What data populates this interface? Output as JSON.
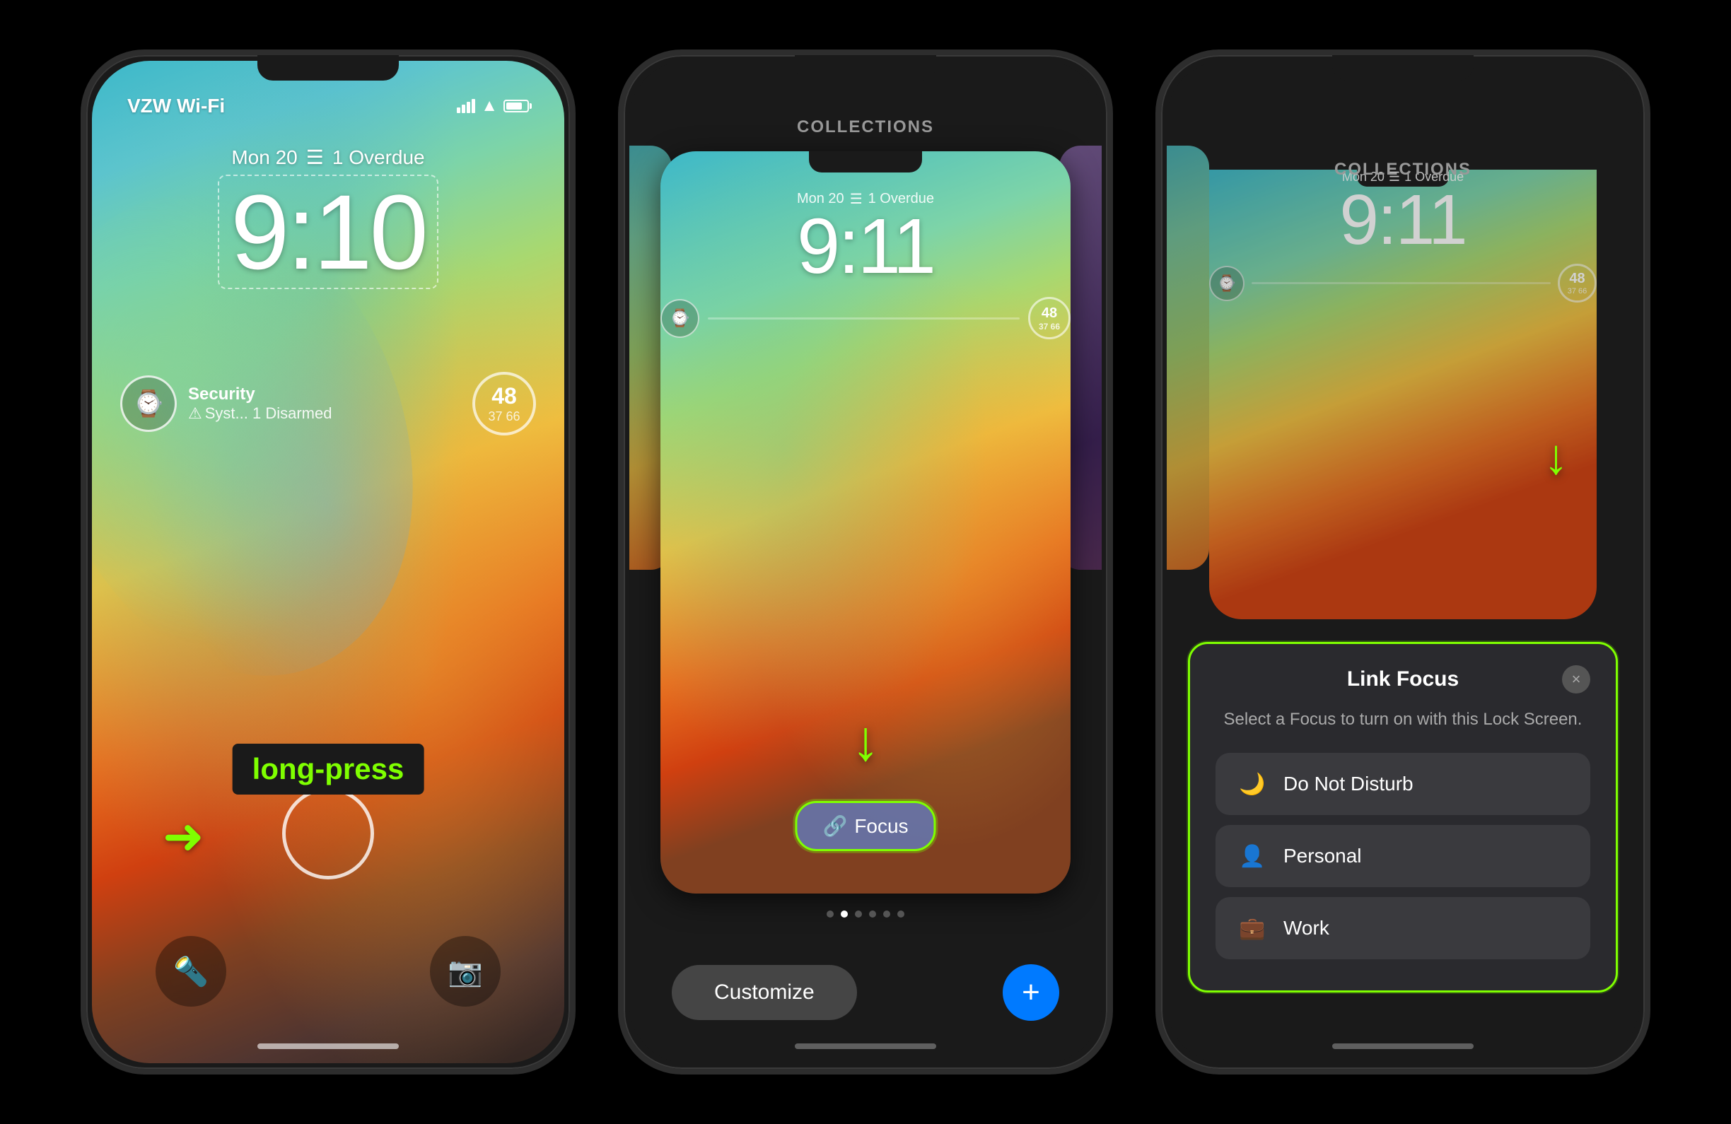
{
  "page": {
    "background": "#000000"
  },
  "phone1": {
    "status": {
      "carrier": "VZW Wi-Fi",
      "time_display": "9:10"
    },
    "date_row": {
      "date": "Mon 20",
      "overdue": "1 Overdue"
    },
    "time": "9:10",
    "widgets": {
      "security_title": "Security",
      "security_sub": "Syst... 1 Disarmed",
      "temp": "48",
      "temp_range": "37  66"
    },
    "annotation": "long-press",
    "bottom": {
      "flashlight_icon": "🔦",
      "camera_icon": "📷"
    }
  },
  "phone2": {
    "title": "COLLECTIONS",
    "time": "9:11",
    "date_row": {
      "date": "Mon 20",
      "overdue": "1 Overdue"
    },
    "focus_button": "Focus",
    "dots_count": 6,
    "active_dot": 1,
    "bottom": {
      "customize": "Customize",
      "plus": "+"
    }
  },
  "phone3": {
    "title": "COLLECTIONS",
    "time": "9:11",
    "date_row": {
      "date": "Mon 20",
      "overdue": "1 Overdue"
    },
    "link_focus": {
      "title": "Link Focus",
      "description": "Select a Focus to turn on with this Lock Screen.",
      "options": [
        {
          "icon": "🌙",
          "label": "Do Not Disturb"
        },
        {
          "icon": "👤",
          "label": "Personal"
        },
        {
          "icon": "💼",
          "label": "Work"
        }
      ],
      "close_icon": "×"
    }
  }
}
